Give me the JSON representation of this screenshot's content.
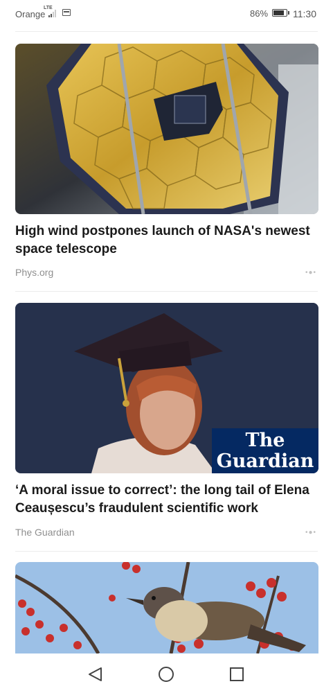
{
  "status_bar": {
    "carrier": "Orange",
    "network": "LTE",
    "battery": "86%",
    "time": "11:30"
  },
  "articles": [
    {
      "headline": "High wind postpones launch of NASA's newest space telescope",
      "source": "Phys.org",
      "image": "James Webb space telescope golden mirror segments"
    },
    {
      "headline": "‘A moral issue to correct’: the long tail of Elena Ceaușescu’s fraudulent scientific work",
      "source": "The Guardian",
      "image": "portrait of woman in graduation cap",
      "badge": {
        "line1": "The",
        "line2": "Guardian",
        "color": "#052962"
      }
    },
    {
      "image": "bird perched on branch with red berries"
    }
  ],
  "nav": {
    "back": "back-icon",
    "home": "home-icon",
    "recents": "recents-icon"
  },
  "colors": {
    "accent_text": "#1a1a1a",
    "source_text": "#8f8f8f"
  }
}
